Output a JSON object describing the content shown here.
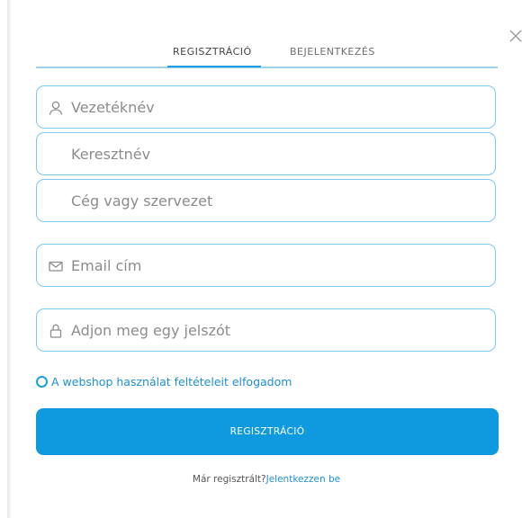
{
  "tabs": {
    "register": "REGISZTRÁCIÓ",
    "login": "BEJELENTKEZÉS",
    "active": "register"
  },
  "form": {
    "last_name": {
      "placeholder": "Vezetéknév",
      "icon": "user-icon"
    },
    "first_name": {
      "placeholder": "Keresztnév"
    },
    "organization": {
      "placeholder": "Cég vagy szervezet"
    },
    "email": {
      "placeholder": "Email cím",
      "icon": "envelope-icon"
    },
    "password": {
      "placeholder": "Adjon meg egy jelszót",
      "icon": "lock-icon"
    }
  },
  "terms": {
    "label": "A webshop használat feltételeit elfogadom",
    "checked": false
  },
  "submit": {
    "label": "REGISZTRÁCIÓ"
  },
  "footer": {
    "prompt": "Már regisztrált?",
    "link": "Jelentkezzen be"
  },
  "colors": {
    "accent": "#0f9ae0",
    "field_border": "#7cc8ea",
    "link": "#1d8fd0"
  }
}
